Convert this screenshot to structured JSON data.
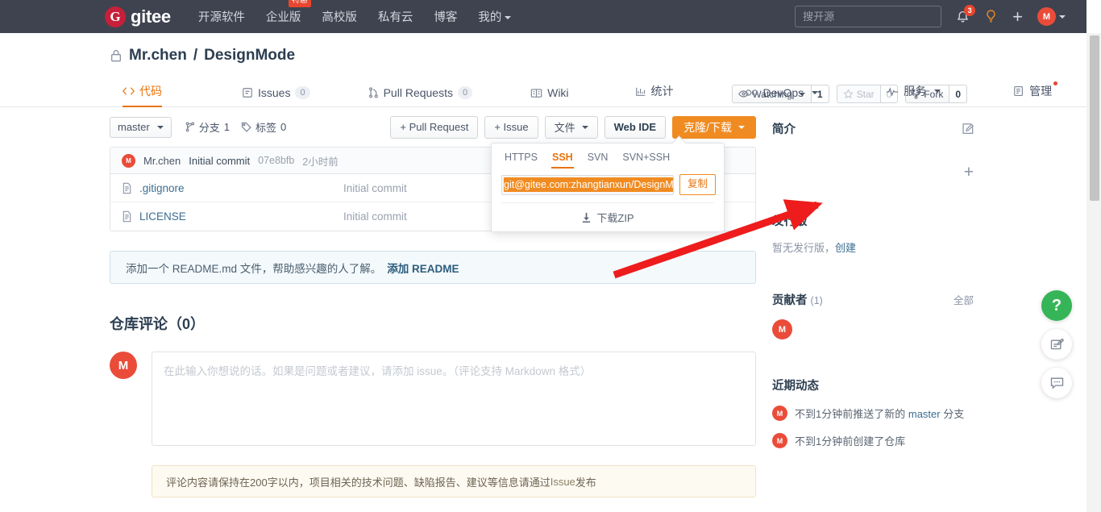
{
  "topnav": {
    "brand": "gitee",
    "brand_mark": "G",
    "links": [
      {
        "label": "开源软件"
      },
      {
        "label": "企业版",
        "badge": "特惠"
      },
      {
        "label": "高校版"
      },
      {
        "label": "私有云"
      },
      {
        "label": "博客"
      },
      {
        "label": "我的",
        "caret": true
      }
    ],
    "search_placeholder": "搜开源",
    "search_value": "",
    "notification_count": "3",
    "avatar_letter": "M"
  },
  "repo": {
    "owner": "Mr.chen",
    "separator": "/",
    "name": "DesignMode",
    "visibility": "private",
    "watch_label": "Watching",
    "watch_count": "1",
    "star_label": "Star",
    "star_count": "0",
    "fork_label": "Fork",
    "fork_count": "0"
  },
  "tabs": [
    {
      "label": "代码",
      "icon": "code-icon",
      "active": true,
      "count": null
    },
    {
      "label": "Issues",
      "icon": "issue-icon",
      "active": false,
      "count": "0"
    },
    {
      "label": "Pull Requests",
      "icon": "pr-icon",
      "active": false,
      "count": "0"
    },
    {
      "label": "Wiki",
      "icon": "wiki-icon",
      "active": false,
      "count": null
    },
    {
      "label": "统计",
      "icon": "chart-icon",
      "active": false,
      "count": null
    },
    {
      "label": "DevOps",
      "icon": "infinity-icon",
      "active": false,
      "count": null,
      "caret": true
    },
    {
      "label": "服务",
      "icon": "pulse-icon",
      "active": false,
      "count": null,
      "caret": true
    },
    {
      "label": "管理",
      "icon": "manage-icon",
      "active": false,
      "count": null,
      "dot": true
    }
  ],
  "toolbar": {
    "branch": "master",
    "branches_label": "分支",
    "branches_count": "1",
    "tags_label": "标签",
    "tags_count": "0",
    "pull_request_btn": "+ Pull Request",
    "issue_btn": "+ Issue",
    "file_btn": "文件",
    "webide_btn": "Web IDE",
    "clone_btn": "克隆/下载"
  },
  "clone_popover": {
    "tabs": [
      "HTTPS",
      "SSH",
      "SVN",
      "SVN+SSH"
    ],
    "active_tab": "SSH",
    "url": "git@gitee.com:zhangtianxun/DesignM",
    "copy_btn": "复制",
    "zip_label": "下载ZIP"
  },
  "commit": {
    "avatar_letter": "M",
    "author": "Mr.chen",
    "message": "Initial commit",
    "sha": "07e8bfb",
    "time": "2小时前"
  },
  "files": [
    {
      "name": ".gitignore",
      "message": "Initial commit",
      "icon": "file-icon"
    },
    {
      "name": "LICENSE",
      "message": "Initial commit",
      "icon": "file-icon"
    }
  ],
  "readme_notice": {
    "text": "添加一个 README.md 文件，帮助感兴趣的人了解。",
    "link": "添加 README"
  },
  "comments": {
    "title": "仓库评论（0）",
    "avatar_letter": "M",
    "placeholder": "在此输入你想说的话。如果是问题或者建议，请添加 issue。（评论支持 Markdown 格式）",
    "value": "",
    "hint_before": "评论内容请保持在200字以内，项目相关的技术问题、缺陷报告、建议等信息请通过 ",
    "hint_link": "Issue",
    "hint_after": " 发布"
  },
  "sidebar": {
    "intro": {
      "title": "简介",
      "action_icon": "edit-icon",
      "plus_icon": "plus-icon"
    },
    "releases": {
      "title": "发行版",
      "empty_text": "暂无发行版，",
      "create_link": "创建"
    },
    "contributors": {
      "title": "贡献者",
      "count": "(1)",
      "all_label": "全部",
      "avatars": [
        "M"
      ]
    },
    "activity": {
      "title": "近期动态",
      "items": [
        {
          "avatar": "M",
          "time": "不到1分钟前",
          "text_before": "推送了新的 ",
          "link": "master",
          "text_after": " 分支"
        },
        {
          "avatar": "M",
          "time": "不到1分钟前",
          "text_before": "创建了仓库",
          "link": "",
          "text_after": ""
        }
      ]
    }
  },
  "fabs": [
    {
      "icon": "help-icon",
      "label": "?",
      "style": "green"
    },
    {
      "icon": "feedback-edit-icon",
      "label": "",
      "style": "white"
    },
    {
      "icon": "comment-icon",
      "label": "",
      "style": "white"
    }
  ],
  "colors": {
    "brand_orange": "#e8740c",
    "primary_button": "#f08b21",
    "navbar_bg": "#3f4350",
    "logo_red": "#c6203a",
    "annotation_red": "#ee1c1c",
    "badge_red": "#e8462f",
    "link_blue": "#3b6e91",
    "fab_green": "#35b558"
  }
}
